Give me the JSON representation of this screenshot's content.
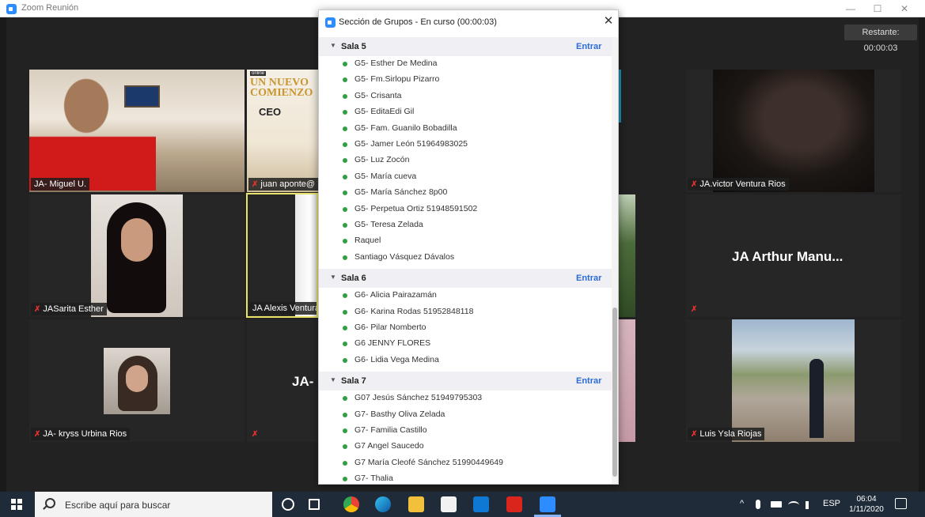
{
  "window": {
    "title": "Zoom Reunión",
    "minimize": "—",
    "maximize": "☐",
    "close": "✕"
  },
  "timer": "Restante: 00:00:03",
  "tiles": {
    "miguel": "JA- Miguel U.",
    "juan": "juan aponte@",
    "victor": "JA.victor Ventura Rios",
    "sarita": "JASarita Esther",
    "alexis": "JA Alexis Ventura",
    "arthur_big": "JA Arthur Manu...",
    "kryss": "JA- kryss Urbina Rios",
    "ja_big": "JA-",
    "luis": "Luis Ysla Riojas"
  },
  "flyer": {
    "banner": "online",
    "line1": "UN NUEVO",
    "line2": "COMIENZO",
    "brand": "CEO"
  },
  "breakout": {
    "title": "Sección de Grupos - En curso (00:00:03)",
    "close": "✕",
    "join_label": "Entrar",
    "rooms": [
      {
        "name": "Sala 5",
        "members": [
          "G5- Esther De Medina",
          "G5- Fm.Sirlopu Pizarro",
          "G5- Crisanta",
          "G5- EditaEdi Gil",
          "G5- Fam. Guanilo Bobadilla",
          "G5- Jamer León 51964983025",
          "G5- Luz Zocón",
          "G5- María cueva",
          "G5- María Sánchez 8p00",
          "G5- Perpetua Ortiz 51948591502",
          "G5- Teresa Zelada",
          "Raquel",
          "Santiago Vásquez Dávalos"
        ]
      },
      {
        "name": "Sala 6",
        "members": [
          "G6- Alicia Pairazamán",
          "G6- Karina Rodas 51952848118",
          "G6- Pilar Nomberto",
          "G6 JENNY FLORES",
          "G6- Lidia Vega Medina"
        ]
      },
      {
        "name": "Sala 7",
        "members": [
          "G07 Jesús Sánchez 51949795303",
          "G7- Basthy Oliva Zelada",
          "G7- Familia Castillo",
          "G7 Angel Saucedo",
          "G7 María Cleofé Sánchez 51990449649",
          "G7- Thalia"
        ]
      }
    ]
  },
  "taskbar": {
    "search_placeholder": "Escribe aquí para buscar",
    "language": "ESP",
    "time": "06:04",
    "date": "1/11/2020"
  }
}
